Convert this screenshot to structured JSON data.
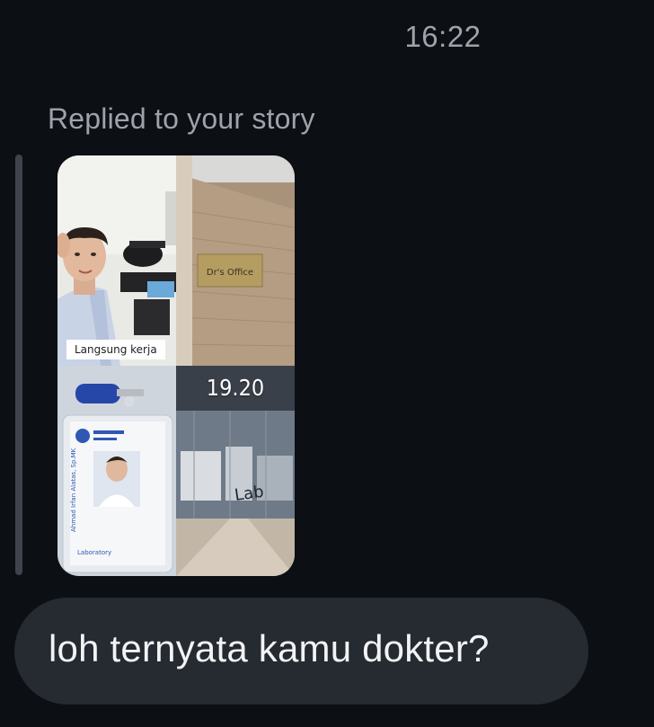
{
  "chat": {
    "timestamp": "16:22",
    "reply_label": "Replied to your story",
    "story": {
      "tiles": [
        {
          "name": "selfie-with-microscope",
          "caption": "Langsung kerja"
        },
        {
          "name": "doctors-office-door",
          "caption": "Dr's Office"
        },
        {
          "name": "hospital-id-card",
          "caption": "Laboratory"
        },
        {
          "name": "laboratory-glass-wall",
          "caption": "19.20"
        }
      ]
    },
    "message": {
      "text": "loh ternyata kamu dokter?"
    }
  },
  "colors": {
    "background": "#0c0f14",
    "bubble": "#262a31",
    "muted_text": "#9ea3ab",
    "message_text": "#f2f3f5",
    "reply_bar": "#3f444c"
  }
}
